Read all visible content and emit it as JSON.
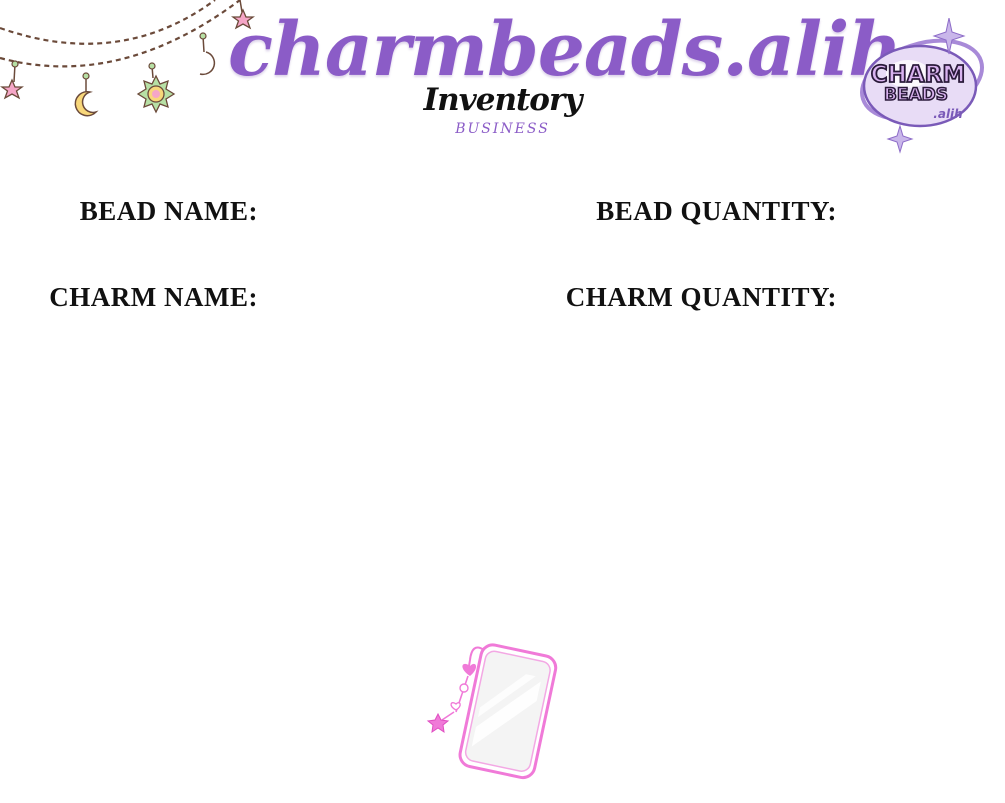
{
  "header": {
    "brand": "charmbeads.alih",
    "subtitle": "Inventory",
    "kicker": "BUSINESS"
  },
  "logo": {
    "line1": "CHARM",
    "line2": "BEADS",
    "line3": ".alih"
  },
  "fields": {
    "bead_name": "BEAD NAME:",
    "bead_quantity": "BEAD QUANTITY:",
    "charm_name": "CHARM NAME:",
    "charm_quantity": "CHARM QUANTITY:"
  },
  "decorations": {
    "garland_icon": "moon-star-sun-garland-icon",
    "phone_icon": "phone-with-charm-strap-icon"
  },
  "colors": {
    "brand_purple": "#8b5cc7",
    "text": "#111111",
    "phone_pink": "#f07ad8",
    "garland_string": "#6b4a3a"
  }
}
